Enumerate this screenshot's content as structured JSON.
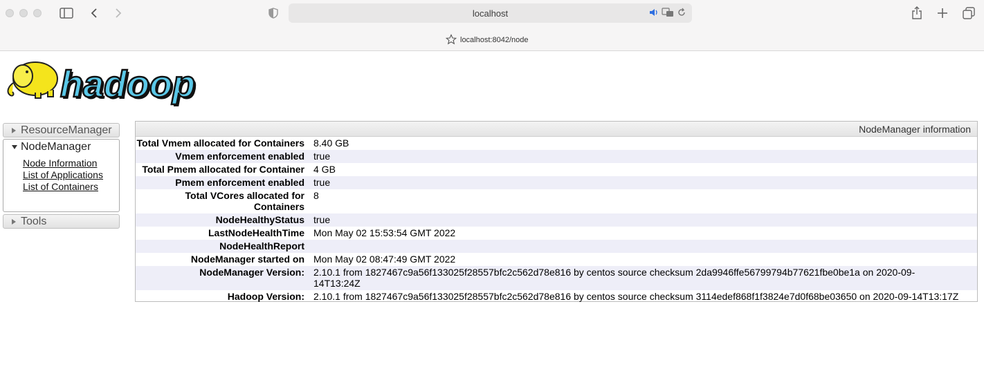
{
  "browser": {
    "address": "localhost",
    "tab_url": "localhost:8042/node"
  },
  "sidebar": {
    "resource_manager": "ResourceManager",
    "node_manager": "NodeManager",
    "links": [
      "Node Information",
      "List of Applications",
      "List of Containers"
    ],
    "tools": "Tools"
  },
  "info": {
    "heading": "NodeManager information",
    "rows": [
      {
        "key": "Total Vmem allocated for Containers",
        "value": "8.40 GB"
      },
      {
        "key": "Vmem enforcement enabled",
        "value": "true"
      },
      {
        "key": "Total Pmem allocated for Container",
        "value": "4 GB"
      },
      {
        "key": "Pmem enforcement enabled",
        "value": "true"
      },
      {
        "key": "Total VCores allocated for Containers",
        "value": "8"
      },
      {
        "key": "NodeHealthyStatus",
        "value": "true"
      },
      {
        "key": "LastNodeHealthTime",
        "value": "Mon May 02 15:53:54 GMT 2022"
      },
      {
        "key": "NodeHealthReport",
        "value": ""
      },
      {
        "key": "NodeManager started on",
        "value": "Mon May 02 08:47:49 GMT 2022"
      },
      {
        "key": "NodeManager Version:",
        "value": "2.10.1 from 1827467c9a56f133025f28557bfc2c562d78e816 by centos source checksum 2da9946ffe56799794b77621fbe0be1a on 2020-09-14T13:24Z"
      },
      {
        "key": "Hadoop Version:",
        "value": "2.10.1 from 1827467c9a56f133025f28557bfc2c562d78e816 by centos source checksum 3114edef868f1f3824e7d0f68be03650 on 2020-09-14T13:17Z"
      }
    ]
  }
}
